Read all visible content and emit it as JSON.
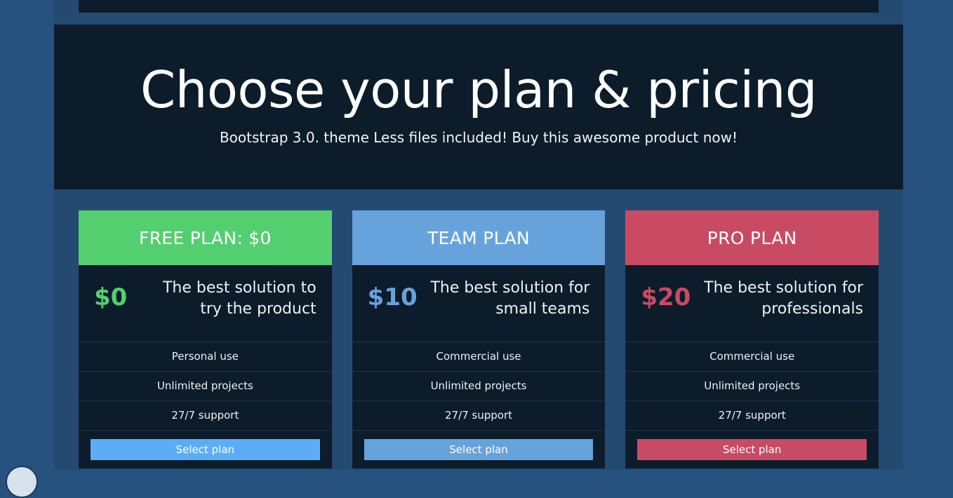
{
  "theme": {
    "page_background": "#27527f",
    "container_background": "#254a72",
    "panel_background": "#0d1c2b",
    "divider": "#1d3349",
    "text_light": "#eef1f4",
    "accent_green": "#53cf70",
    "accent_blue": "#67a3db",
    "accent_red": "#c94a63",
    "button_blue": "#5badf7"
  },
  "hero": {
    "title": "Choose your plan & pricing",
    "subtitle": "Bootstrap 3.0. theme Less files included! Buy this awesome product now!"
  },
  "pricing": {
    "plans": [
      {
        "header": "FREE PLAN: $0",
        "price": "$0",
        "description": "The best solution to try the product",
        "features": [
          "Personal use",
          "Unlimited projects",
          "27/7 support"
        ],
        "cta": "Select plan",
        "accent": "#53cf70",
        "button_color": "#5badf7"
      },
      {
        "header": "TEAM PLAN",
        "price": "$10",
        "description": "The best solution for small teams",
        "features": [
          "Commercial use",
          "Unlimited projects",
          "27/7 support"
        ],
        "cta": "Select plan",
        "accent": "#67a3db",
        "button_color": "#67a3db"
      },
      {
        "header": "PRO PLAN",
        "price": "$20",
        "description": "The best solution for professionals",
        "features": [
          "Commercial use",
          "Unlimited projects",
          "27/7 support"
        ],
        "cta": "Select plan",
        "accent": "#c94a63",
        "button_color": "#c94a63"
      }
    ]
  },
  "widgets": {
    "floating_button": "chat-bubble-icon"
  }
}
